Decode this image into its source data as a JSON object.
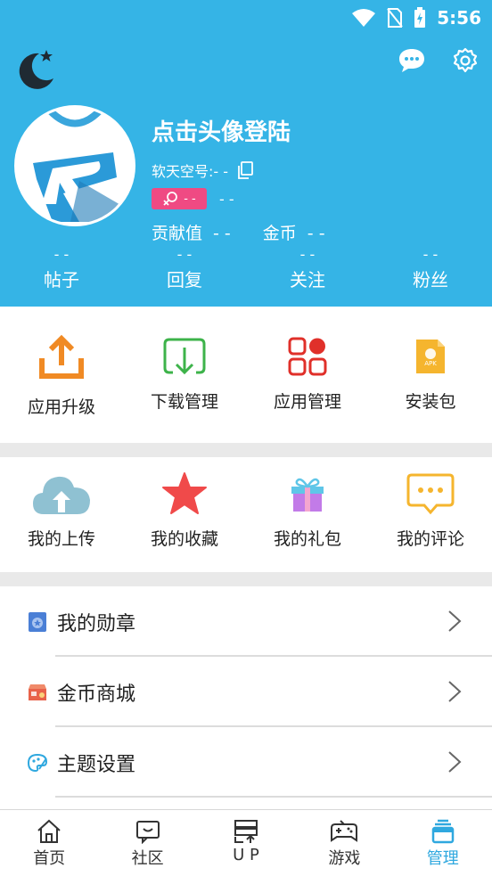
{
  "status_bar": {
    "time": "5:56"
  },
  "profile": {
    "name": "点击头像登陆",
    "account": "软天空号:- -",
    "badge_value": "- -",
    "badge_extra": "- -",
    "contribution_label": "贡献值",
    "contribution_value": "- -",
    "coins_label": "金币",
    "coins_value": "- -"
  },
  "counts": [
    {
      "value": "- -",
      "label": "帖子"
    },
    {
      "value": "- -",
      "label": "回复"
    },
    {
      "value": "- -",
      "label": "关注"
    },
    {
      "value": "- -",
      "label": "粉丝"
    }
  ],
  "grid1": [
    {
      "label": "应用升级",
      "icon": "upload-tray-icon"
    },
    {
      "label": "下载管理",
      "icon": "download-icon"
    },
    {
      "label": "应用管理",
      "icon": "apps-grid-icon"
    },
    {
      "label": "安装包",
      "icon": "apk-file-icon"
    }
  ],
  "grid2": [
    {
      "label": "我的上传",
      "icon": "cloud-upload-icon"
    },
    {
      "label": "我的收藏",
      "icon": "star-icon"
    },
    {
      "label": "我的礼包",
      "icon": "gift-icon"
    },
    {
      "label": "我的评论",
      "icon": "comment-icon"
    }
  ],
  "menu": [
    {
      "label": "我的勋章",
      "icon": "medal-icon"
    },
    {
      "label": "金币商城",
      "icon": "shop-icon"
    },
    {
      "label": "主题设置",
      "icon": "palette-icon"
    }
  ],
  "tabs": [
    {
      "label": "首页",
      "icon": "home-icon"
    },
    {
      "label": "社区",
      "icon": "community-icon"
    },
    {
      "label": "U P",
      "icon": "up-server-icon"
    },
    {
      "label": "游戏",
      "icon": "gamepad-icon"
    },
    {
      "label": "管理",
      "icon": "manage-icon",
      "active": true
    }
  ],
  "colors": {
    "header": "#35b4e6",
    "active_tab": "#2fa8df",
    "badge": "#ef4a83"
  }
}
